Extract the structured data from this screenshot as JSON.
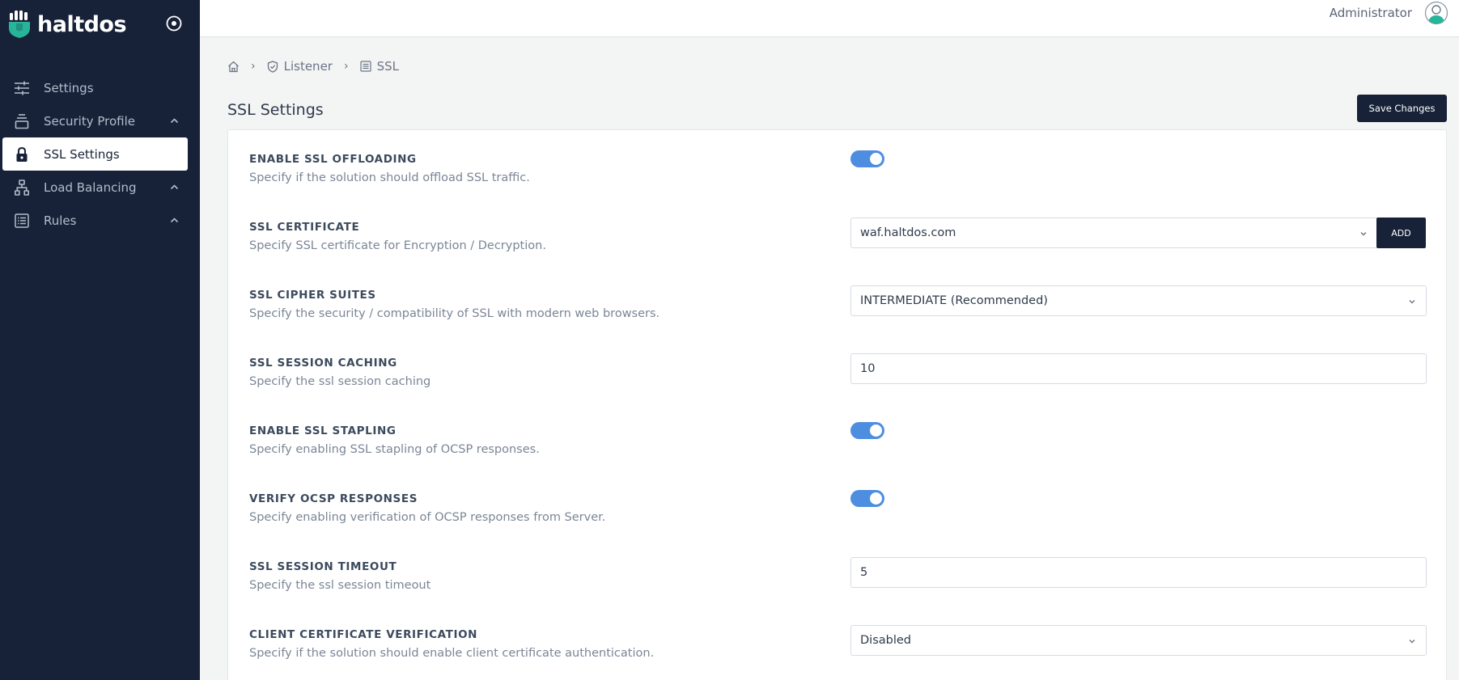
{
  "app": {
    "brand": "haltdos"
  },
  "header": {
    "user_name": "Administrator"
  },
  "sidebar": {
    "items": [
      {
        "label": "Settings",
        "icon": "sliders-icon",
        "expandable": false,
        "active": false
      },
      {
        "label": "Security Profile",
        "icon": "layers-icon",
        "expandable": true,
        "active": false
      },
      {
        "label": "SSL Settings",
        "icon": "lock-icon",
        "expandable": false,
        "active": true
      },
      {
        "label": "Load Balancing",
        "icon": "sitemap-icon",
        "expandable": true,
        "active": false
      },
      {
        "label": "Rules",
        "icon": "list-icon",
        "expandable": true,
        "active": false
      }
    ]
  },
  "breadcrumb": {
    "items": [
      {
        "label": "",
        "icon": "home-icon"
      },
      {
        "label": "Listener",
        "icon": "shield-icon"
      },
      {
        "label": "SSL",
        "icon": "list-icon"
      }
    ]
  },
  "page": {
    "title": "SSL Settings",
    "save_label": "Save Changes"
  },
  "settings": [
    {
      "label": "ENABLE SSL OFFLOADING",
      "desc": "Specify if the solution should offload SSL traffic.",
      "control": "toggle",
      "on": true
    },
    {
      "label": "SSL CERTIFICATE",
      "desc": "Specify SSL certificate for Encryption / Decryption.",
      "control": "select-add",
      "value": "waf.haltdos.com",
      "add_label": "ADD"
    },
    {
      "label": "SSL CIPHER SUITES",
      "desc": "Specify the security / compatibility of SSL with modern web browsers.",
      "control": "select",
      "value": "INTERMEDIATE (Recommended)"
    },
    {
      "label": "SSL SESSION CACHING",
      "desc": "Specify the ssl session caching",
      "control": "input",
      "value": "10"
    },
    {
      "label": "ENABLE SSL STAPLING",
      "desc": "Specify enabling SSL stapling of OCSP responses.",
      "control": "toggle",
      "on": true
    },
    {
      "label": "VERIFY OCSP RESPONSES",
      "desc": "Specify enabling verification of OCSP responses from Server.",
      "control": "toggle",
      "on": true
    },
    {
      "label": "SSL SESSION TIMEOUT",
      "desc": "Specify the ssl session timeout",
      "control": "input",
      "value": "5"
    },
    {
      "label": "CLIENT CERTIFICATE VERIFICATION",
      "desc": "Specify if the solution should enable client certificate authentication.",
      "control": "select",
      "value": "Disabled"
    }
  ],
  "colors": {
    "sidebar_bg": "#172238",
    "toggle_on": "#4d8ee0",
    "brand_accent": "#27b59a"
  }
}
